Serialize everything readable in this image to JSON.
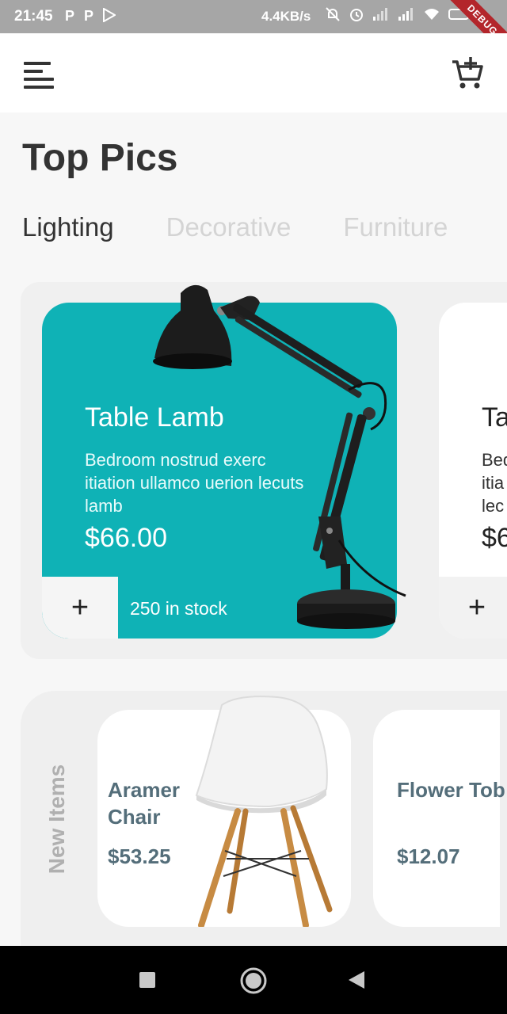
{
  "status_bar": {
    "time": "21:45",
    "left_icons": [
      "P",
      "P"
    ],
    "speed": "4.4KB/s",
    "debug_banner": "DEBUG"
  },
  "app_bar": {
    "menu_icon": "menu-icon",
    "cart_icon": "add-to-cart-icon"
  },
  "page_title": "Top Pics",
  "tabs": [
    {
      "label": "Lighting",
      "active": true
    },
    {
      "label": "Decorative",
      "active": false
    },
    {
      "label": "Furniture",
      "active": false
    }
  ],
  "featured": [
    {
      "name": "Table Lamb",
      "description": "Bedroom nostrud exerc itiation ullamco uerion lecuts lamb",
      "price": "$66.00",
      "stock": "250 in stock",
      "add_label": "+",
      "color": "#0fb2b6"
    },
    {
      "name": "Ta",
      "description_lines": [
        "Bed",
        "itia",
        "lec"
      ],
      "price": "$6",
      "add_label": "+",
      "color": "#ffffff"
    }
  ],
  "new_items": {
    "label": "New Items",
    "items": [
      {
        "name": "Aramer Chair",
        "price": "$53.25"
      },
      {
        "name": "Flower Tob",
        "price": "$12.07"
      }
    ]
  },
  "colors": {
    "accent": "#0fb2b6",
    "text_dark": "#333333",
    "muted_tab": "#d4d4d4",
    "item_text": "#546e7a"
  }
}
